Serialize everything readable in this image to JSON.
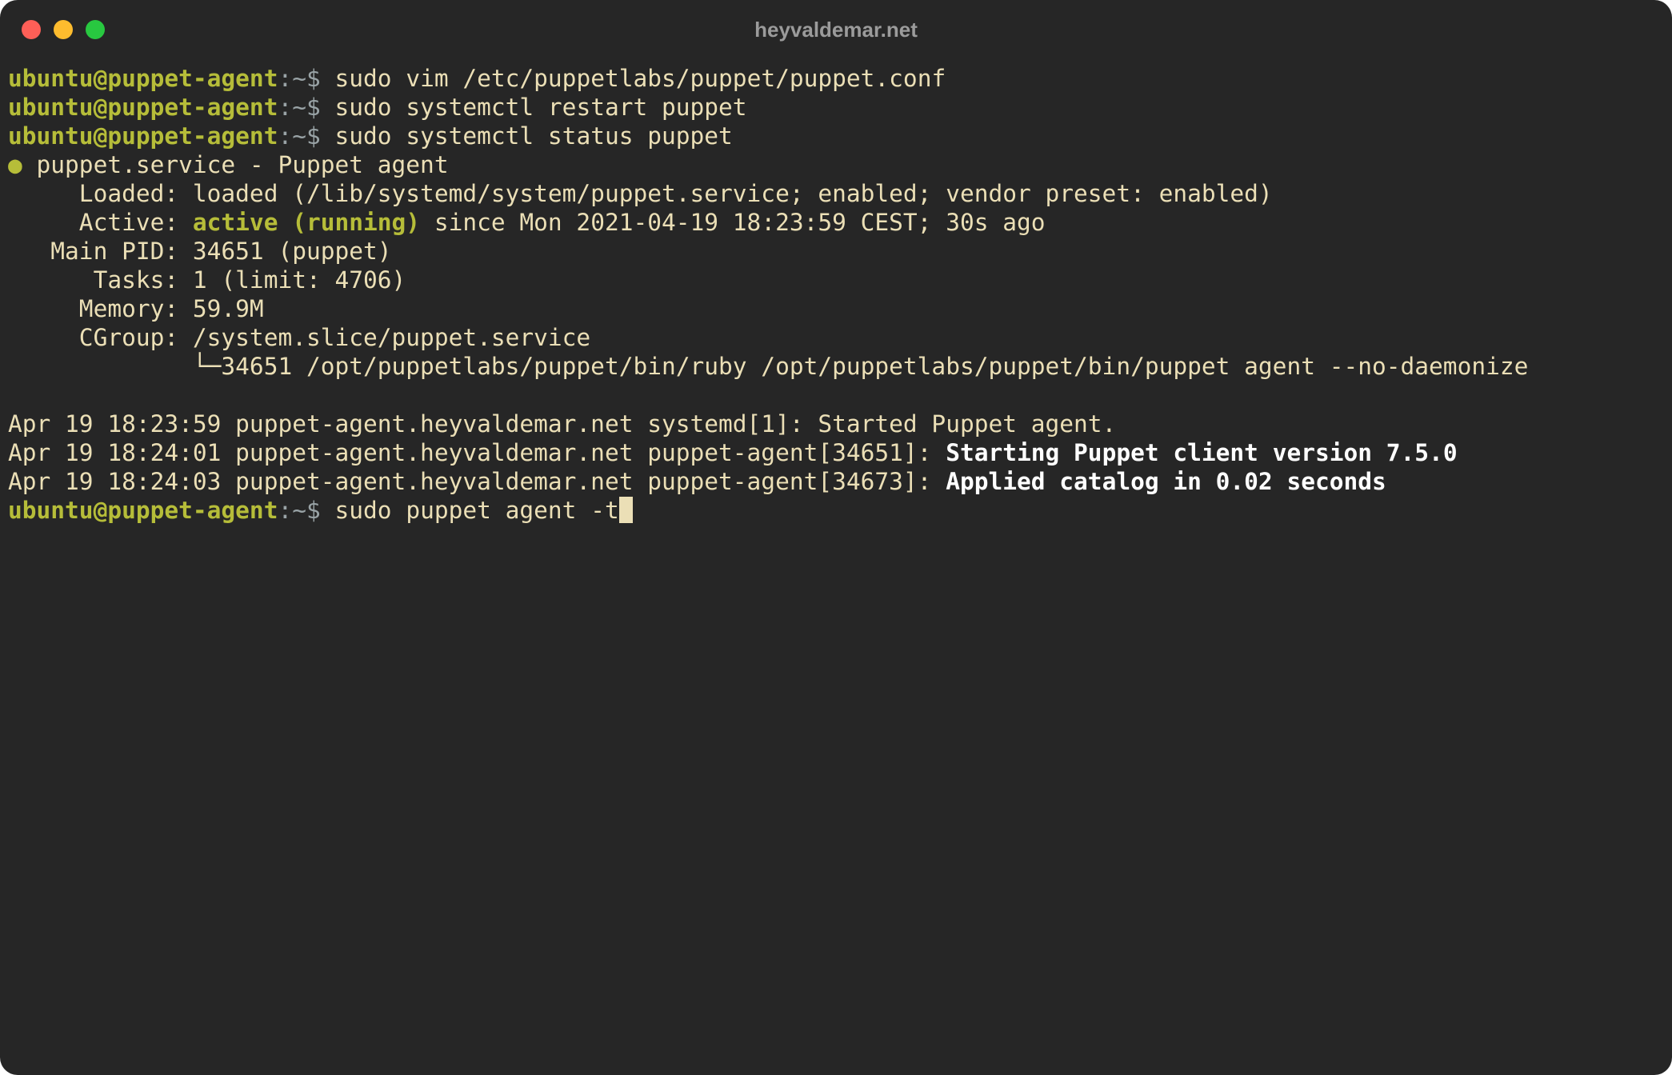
{
  "window": {
    "title": "heyvaldemar.net"
  },
  "prompt": {
    "user_host": "ubuntu@puppet-agent",
    "sep": ":",
    "path_sym": "~$ "
  },
  "commands": {
    "c1": "sudo vim /etc/puppetlabs/puppet/puppet.conf",
    "c2": "sudo systemctl restart puppet",
    "c3": "sudo systemctl status puppet",
    "current": "sudo puppet agent -t"
  },
  "status": {
    "bullet": "●",
    "header": " puppet.service - Puppet agent",
    "loaded": "     Loaded: loaded (/lib/systemd/system/puppet.service; enabled; vendor preset: enabled)",
    "active_prefix": "     Active: ",
    "active_state": "active (running)",
    "active_suffix": " since Mon 2021-04-19 18:23:59 CEST; 30s ago",
    "main_pid": "   Main PID: 34651 (puppet)",
    "tasks": "      Tasks: 1 (limit: 4706)",
    "memory": "     Memory: 59.9M",
    "cgroup": "     CGroup: /system.slice/puppet.service",
    "cgroup_child": "             └─34651 /opt/puppetlabs/puppet/bin/ruby /opt/puppetlabs/puppet/bin/puppet agent --no-daemonize"
  },
  "logs": {
    "l1": "Apr 19 18:23:59 puppet-agent.heyvaldemar.net systemd[1]: Started Puppet agent.",
    "l2_prefix": "Apr 19 18:24:01 puppet-agent.heyvaldemar.net puppet-agent[34651]: ",
    "l2_msg": "Starting Puppet client version 7.5.0",
    "l3_prefix": "Apr 19 18:24:03 puppet-agent.heyvaldemar.net puppet-agent[34673]: ",
    "l3_msg": "Applied catalog in 0.02 seconds"
  },
  "colors": {
    "background": "#262626",
    "prompt_green": "#b6bd39",
    "text": "#ebdfb6",
    "bold_white": "#ffffff"
  }
}
